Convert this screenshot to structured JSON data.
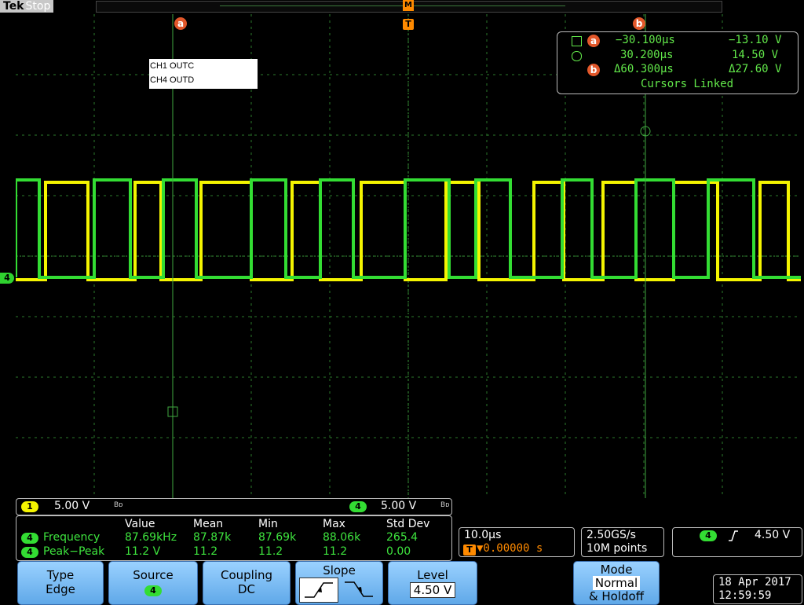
{
  "brand": {
    "name": "Tek",
    "state": "Stop"
  },
  "trigger_marker": {
    "label": "T",
    "m_label": "M"
  },
  "cursors": {
    "a_label": "a",
    "b_label": "b"
  },
  "notes": [
    "CH1 OUTC",
    "CH4 OUTD"
  ],
  "readout": {
    "row_a": {
      "time": "−30.100µs",
      "volt": "−13.10 V"
    },
    "row_b": {
      "time": "30.200µs",
      "volt": "14.50 V"
    },
    "delta": {
      "time": "Δ60.300µs",
      "volt": "Δ27.60 V"
    },
    "linked": "Cursors Linked"
  },
  "channel_marker": "4",
  "scale": {
    "ch1_num": "1",
    "ch1": "5.00 V",
    "ch4_num": "4",
    "ch4": "5.00 V",
    "bw": "Bᴅ"
  },
  "measurements": {
    "headers": [
      "Value",
      "Mean",
      "Min",
      "Max",
      "Std Dev"
    ],
    "rows": [
      {
        "ch": "4",
        "name": "Frequency",
        "value": "87.69kHz",
        "mean": "87.87k",
        "min": "87.69k",
        "max": "88.06k",
        "std": "265.4"
      },
      {
        "ch": "4",
        "name": "Peak−Peak",
        "value": "11.2 V",
        "mean": "11.2",
        "min": "11.2",
        "max": "11.2",
        "std": "0.00"
      }
    ]
  },
  "horizontal": {
    "scale": "10.0µs",
    "delay": "▼0.00000 s"
  },
  "acquisition": {
    "rate": "2.50GS/s",
    "points": "10M points"
  },
  "trigger_readout": {
    "ch": "4",
    "level": "4.50 V"
  },
  "buttons": {
    "type": {
      "label": "Type",
      "value": "Edge"
    },
    "source": {
      "label": "Source",
      "value": "4"
    },
    "coupling": {
      "label": "Coupling",
      "value": "DC"
    },
    "slope": {
      "label": "Slope"
    },
    "level": {
      "label": "Level",
      "value": "4.50 V"
    },
    "mode": {
      "l1": "Mode",
      "l2": "Normal",
      "l3": "& Holdoff"
    }
  },
  "datetime": {
    "date": "18 Apr 2017",
    "time": "12:59:59"
  },
  "colors": {
    "ch1": "#f4f400",
    "ch4": "#33dd33",
    "grid": "#2c7a2c",
    "cursor": "#3fa83f",
    "accent": "#e2572a"
  }
}
